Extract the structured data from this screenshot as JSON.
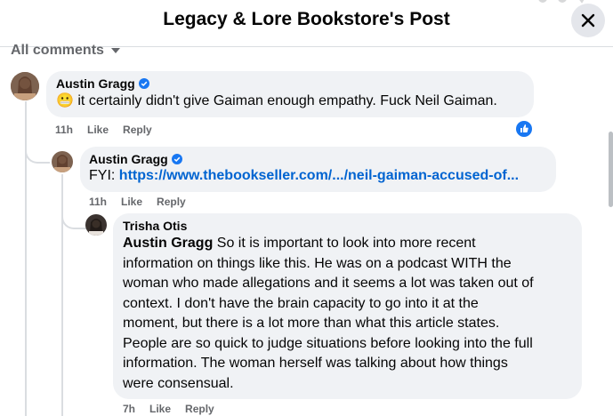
{
  "header": {
    "title": "Legacy & Lore Bookstore's Post"
  },
  "filter": {
    "label": "All comments"
  },
  "comments": [
    {
      "author": "Austin Gragg",
      "verified": true,
      "emoji": "😬",
      "text": "it certainly didn't give Gaiman enough empathy. Fuck Neil Gaiman.",
      "time": "11h",
      "like": "Like",
      "reply": "Reply"
    },
    {
      "author": "Austin Gragg",
      "verified": true,
      "prefix": "FYI:",
      "link": "https://www.thebookseller.com/.../neil-gaiman-accused-of...",
      "time": "11h",
      "like": "Like",
      "reply": "Reply"
    },
    {
      "author": "Trisha Otis",
      "mention": "Austin Gragg",
      "lines": [
        " So it is important to look into more recent",
        "information on things like this. He was on a podcast WITH the",
        "woman who made allegations and it seems a lot was taken out of",
        "context. I don't have the brain capacity to go into it at the",
        "moment, but there is a lot more than what this article states.",
        "People are so quick to judge situations before looking into the full",
        "information. The woman herself was talking about how things",
        "were consensual."
      ],
      "time": "7h",
      "like": "Like",
      "reply": "Reply"
    }
  ],
  "colors": {
    "link": "#0064d1",
    "verified": "#1877f2",
    "bubble": "#f0f2f5",
    "meta": "#65676b"
  }
}
